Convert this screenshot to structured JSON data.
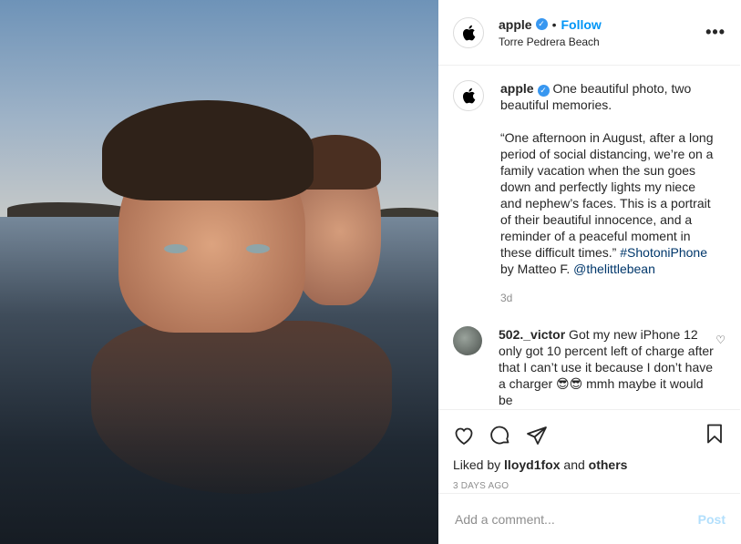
{
  "header": {
    "username": "apple",
    "verified": "✓",
    "separator": "•",
    "follow_label": "Follow",
    "location": "Torre Pedrera Beach",
    "more_label": "•••"
  },
  "caption": {
    "username": "apple",
    "verified": "✓",
    "text": " One beautiful photo, two beautiful memories.\n\n“One afternoon in August, after a long period of social distancing, we’re on a family vacation when the sun goes down and perfectly lights my niece and nephew’s faces. This is a portrait of their beautiful innocence, and a reminder of a peaceful moment in these difficult times.” ",
    "hashtag": "#ShotoniPhone",
    "by_text": " by Matteo F. ",
    "mention": "@thelittlebean",
    "time": "3d"
  },
  "comment": {
    "username": "502._victor",
    "text": " Got my new iPhone 12 only got 10 percent left of charge after that I can’t use it because I don’t have a charger 😎😎 mmh maybe it would be",
    "like_icon": "♡"
  },
  "actions": {
    "liked_by_prefix": "Liked by ",
    "liked_by_user": "lloyd1fox",
    "liked_by_mid": " and ",
    "liked_by_others": "others",
    "date": "3 DAYS AGO"
  },
  "add_comment": {
    "placeholder": "Add a comment...",
    "post_label": "Post"
  },
  "colors": {
    "accent": "#0095f6",
    "verified": "#3897f0",
    "link": "#00376b"
  }
}
